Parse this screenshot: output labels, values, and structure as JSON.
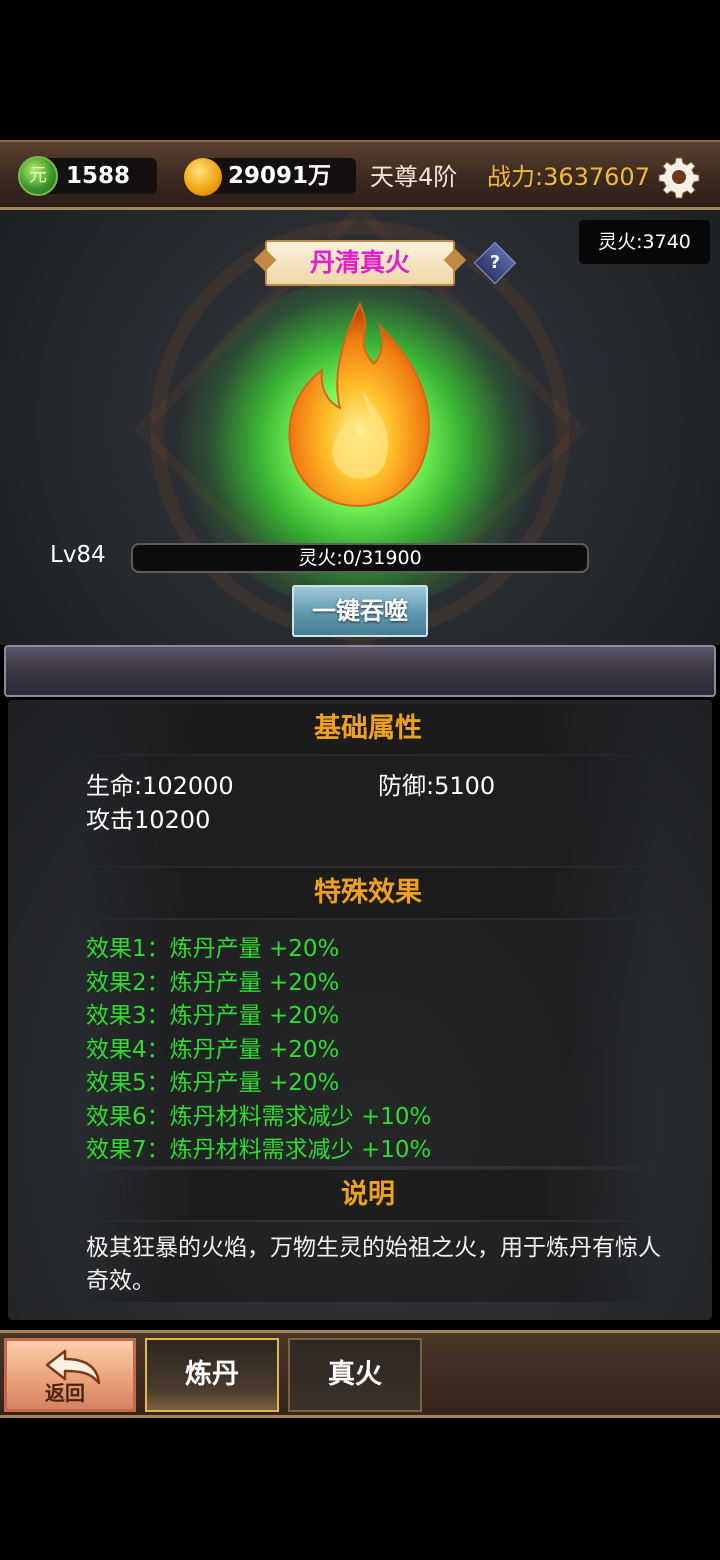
{
  "top_bar": {
    "jade_amount": "1588",
    "gold_amount": "29091万",
    "realm": "天尊4阶",
    "combat_power": "战力:3637607"
  },
  "fire": {
    "name": "丹清真火",
    "spirit_fire_total": "灵火:3740",
    "level": "Lv84",
    "exp_text": "灵火:0/31900",
    "exp_progress": 0,
    "devour_button": "一键吞噬"
  },
  "base_attributes": {
    "title": "基础属性",
    "hp": "生命:102000",
    "defense": "防御:5100",
    "attack": "攻击10200"
  },
  "special_effects": {
    "title": "特殊效果",
    "items": [
      "效果1：炼丹产量 +20%",
      "效果2：炼丹产量 +20%",
      "效果3：炼丹产量 +20%",
      "效果4：炼丹产量 +20%",
      "效果5：炼丹产量 +20%",
      "效果6：炼丹材料需求减少 +10%",
      "效果7：炼丹材料需求减少 +10%"
    ],
    "color": "#2fdc2f"
  },
  "description": {
    "title": "说明",
    "text": "极其狂暴的火焰，万物生灵的始祖之火，用于炼丹有惊人奇效。"
  },
  "bottom_nav": {
    "back_label": "返回",
    "tabs": [
      "炼丹",
      "真火"
    ],
    "active_tab": "炼丹"
  },
  "colors": {
    "accent_gold": "#f0a020",
    "power_color": "#f0b93a",
    "fire_name_color": "#e020c8",
    "glow_green": "#7dff5a"
  }
}
